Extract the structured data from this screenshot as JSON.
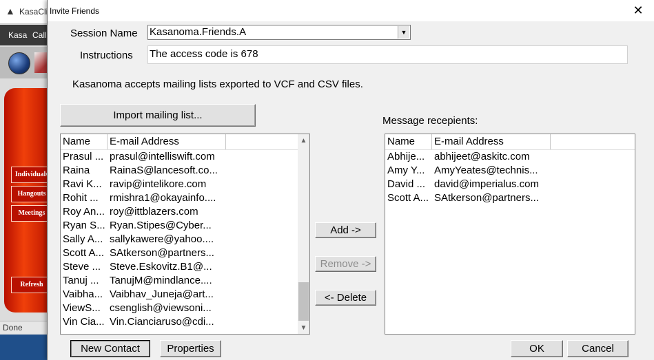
{
  "background_app": {
    "title": "KasaCli",
    "menu": [
      "Kasa",
      "Call"
    ],
    "side_buttons": [
      "Individuals",
      "Hangouts",
      "Meetings",
      "Refresh"
    ],
    "status": "Done"
  },
  "dialog": {
    "title": "Invite Friends",
    "close_icon": "close-icon",
    "session_name_label": "Session Name",
    "session_name_value": "Kasanoma.Friends.A",
    "instructions_label": "Instructions",
    "instructions_value": "The access code is 678",
    "info_text": "Kasanoma accepts mailing lists exported to VCF and CSV files.",
    "import_button": "Import mailing list...",
    "recipients_label": "Message recepients:",
    "add_button": "Add ->",
    "remove_button": "Remove ->",
    "delete_button": "<- Delete",
    "new_contact_button": "New Contact",
    "properties_button": "Properties",
    "ok_button": "OK",
    "cancel_button": "Cancel"
  },
  "contacts": {
    "columns": [
      "Name",
      "E-mail Address"
    ],
    "rows": [
      [
        "Prasul ...",
        "prasul@intelliswift.com"
      ],
      [
        "Raina",
        "RainaS@lancesoft.co..."
      ],
      [
        "Ravi K...",
        "ravip@intelikore.com"
      ],
      [
        "Rohit ...",
        "rmishra1@okayainfo...."
      ],
      [
        "Roy An...",
        "roy@ittblazers.com"
      ],
      [
        "Ryan S...",
        "Ryan.Stipes@Cyber..."
      ],
      [
        "Sally A...",
        "sallykawere@yahoo...."
      ],
      [
        "Scott A...",
        "SAtkerson@partners..."
      ],
      [
        "Steve ...",
        "Steve.Eskovitz.B1@..."
      ],
      [
        "Tanuj ...",
        "TanujM@mindlance...."
      ],
      [
        "Vaibha...",
        "Vaibhav_Juneja@art..."
      ],
      [
        "ViewS...",
        "csenglish@viewsoni..."
      ],
      [
        "Vin Cia...",
        "Vin.Cianciaruso@cdi..."
      ]
    ]
  },
  "recipients": {
    "columns": [
      "Name",
      "E-mail Address"
    ],
    "rows": [
      [
        "Abhije...",
        "abhijeet@askitc.com"
      ],
      [
        "Amy Y...",
        "AmyYeates@technis..."
      ],
      [
        "David ...",
        "david@imperialus.com"
      ],
      [
        "Scott A...",
        "SAtkerson@partners..."
      ]
    ]
  }
}
